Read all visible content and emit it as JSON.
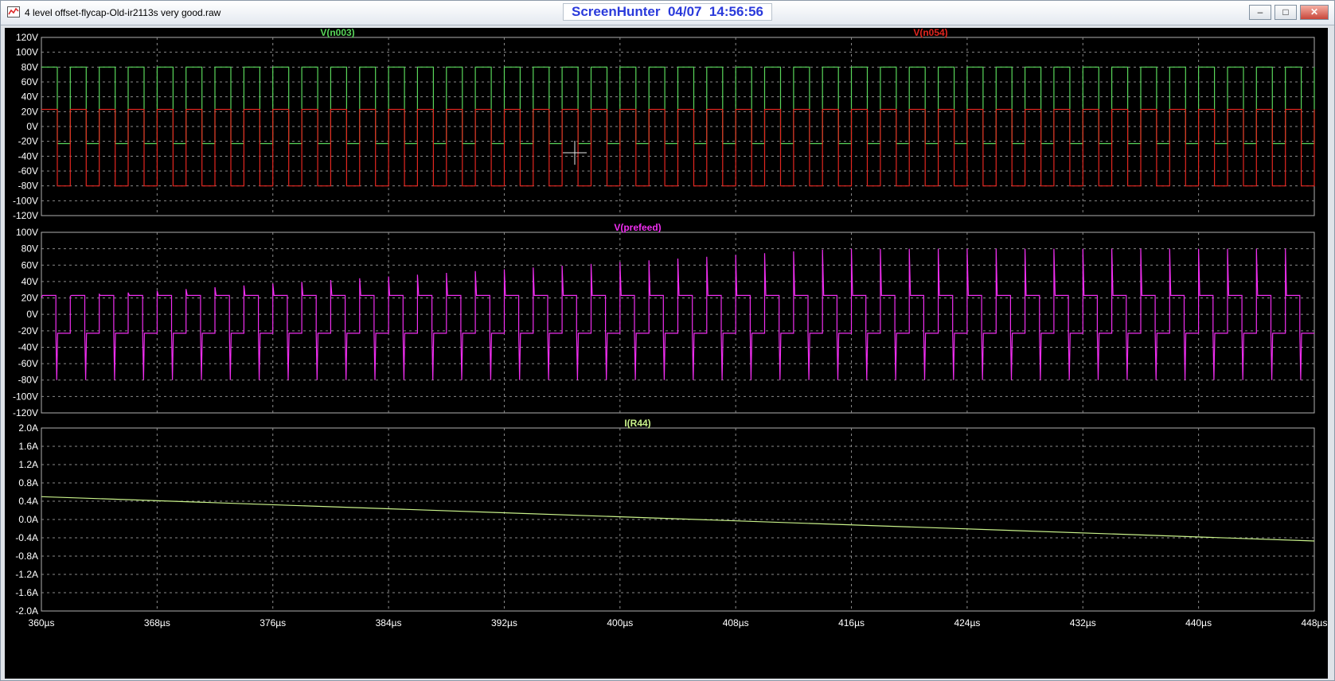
{
  "window": {
    "title": "4 level offset-flycap-Old-ir2113s very good.raw",
    "overlay_text": "ScreenHunter  04/07  14:56:56",
    "controls": {
      "minimize": "–",
      "maximize": "□",
      "close": "✕"
    }
  },
  "colors": {
    "green": "#59d65a",
    "red": "#e2261f",
    "magenta": "#f02ef0",
    "yellowgreen": "#c9f28a",
    "grid": "#8a8a8a",
    "axis_text": "#ffffff"
  },
  "chart_data": [
    {
      "type": "line",
      "name": "pane-top",
      "xlim": [
        360,
        448
      ],
      "ylim": [
        -120,
        120
      ],
      "yticks": [
        120,
        100,
        80,
        60,
        40,
        20,
        0,
        -20,
        -40,
        -60,
        -80,
        -100,
        -120
      ],
      "ytick_labels": [
        "120V",
        "100V",
        "80V",
        "60V",
        "40V",
        "20V",
        "0V",
        "-20V",
        "-40V",
        "-60V",
        "-80V",
        "-100V",
        "-120V"
      ],
      "series": [
        {
          "name": "V(n003)",
          "color": "green",
          "pattern": "square",
          "high": 80,
          "low": -23,
          "period": 2.0,
          "duty": 0.55,
          "phase": 0.0
        },
        {
          "name": "V(n054)",
          "color": "red",
          "pattern": "square",
          "high": 23,
          "low": -80,
          "period": 2.0,
          "duty": 0.55,
          "phase": 0.0
        }
      ]
    },
    {
      "type": "line",
      "name": "pane-middle",
      "xlim": [
        360,
        448
      ],
      "ylim": [
        -120,
        100
      ],
      "yticks": [
        100,
        80,
        60,
        40,
        20,
        0,
        -20,
        -40,
        -60,
        -80,
        -100,
        -120
      ],
      "ytick_labels": [
        "100V",
        "80V",
        "60V",
        "40V",
        "20V",
        "0V",
        "-20V",
        "-40V",
        "-60V",
        "-80V",
        "-100V",
        "-120V"
      ],
      "series": [
        {
          "name": "V(prefeed)",
          "color": "magenta",
          "pattern": "pulsed",
          "high": 23,
          "low": -23,
          "spike_high_start": 20,
          "spike_high_end": 80,
          "spike_low": -80,
          "period": 2.0
        }
      ]
    },
    {
      "type": "line",
      "name": "pane-bottom",
      "xlim": [
        360,
        448
      ],
      "ylim": [
        -2.0,
        2.0
      ],
      "yticks": [
        2.0,
        1.6,
        1.2,
        0.8,
        0.4,
        0.0,
        -0.4,
        -0.8,
        -1.2,
        -1.6,
        -2.0
      ],
      "ytick_labels": [
        "2.0A",
        "1.6A",
        "1.2A",
        "0.8A",
        "0.4A",
        "0.0A",
        "-0.4A",
        "-0.8A",
        "-1.2A",
        "-1.6A",
        "-2.0A"
      ],
      "series": [
        {
          "name": "I(R44)",
          "color": "yellowgreen",
          "x": [
            360,
            448
          ],
          "y": [
            0.5,
            -0.47
          ]
        }
      ]
    }
  ],
  "x_axis": {
    "ticks": [
      360,
      368,
      376,
      384,
      392,
      400,
      408,
      416,
      424,
      432,
      440,
      448
    ],
    "tick_labels": [
      "360µs",
      "368µs",
      "376µs",
      "384µs",
      "392µs",
      "400µs",
      "408µs",
      "416µs",
      "424µs",
      "432µs",
      "440µs",
      "448µs"
    ]
  }
}
